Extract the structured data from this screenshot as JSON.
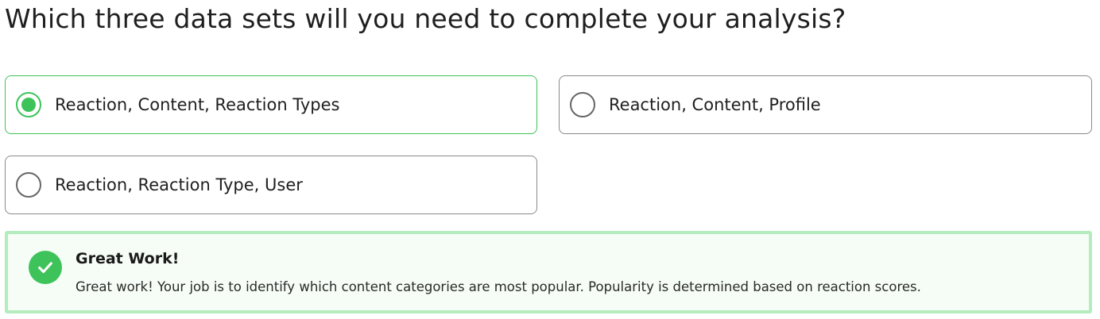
{
  "question": {
    "text": "Which three data sets will you need to complete your analysis?"
  },
  "options": [
    {
      "label": "Reaction, Content, Reaction Types",
      "selected": true
    },
    {
      "label": "Reaction, Content, Profile",
      "selected": false
    },
    {
      "label": "Reaction, Reaction Type, User",
      "selected": false
    }
  ],
  "feedback": {
    "icon": "check-icon",
    "title": "Great Work!",
    "body": "Great work! Your job is to identify which content categories are most popular. Popularity is determined based on reaction scores."
  },
  "colors": {
    "accent_green": "#3ec35a",
    "feedback_border": "#b4ecbe",
    "feedback_background": "#f5fdf6",
    "option_border": "#8a8a8a"
  }
}
